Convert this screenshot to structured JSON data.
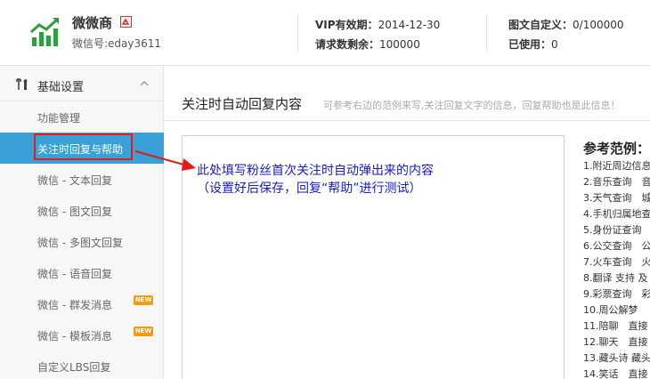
{
  "header": {
    "brand_name": "微微商",
    "wechat_id": "微信号:eday3611",
    "vip_label": "VIP有效期：",
    "vip_value": "2014-12-30",
    "requests_label": "请求数剩余：",
    "requests_value": "100000",
    "custom_label": "图文自定义：",
    "custom_value": "0/100000",
    "used_label": "已使用：",
    "used_value": "0"
  },
  "sidebar": {
    "group_title": "基础设置",
    "items": [
      {
        "label": "功能管理",
        "active": false,
        "new": false
      },
      {
        "label": "关注时回复与帮助",
        "active": true,
        "new": false
      },
      {
        "label": "微信 - 文本回复",
        "active": false,
        "new": false
      },
      {
        "label": "微信 - 图文回复",
        "active": false,
        "new": false
      },
      {
        "label": "微信 - 多图文回复",
        "active": false,
        "new": false
      },
      {
        "label": "微信 - 语音回复",
        "active": false,
        "new": false
      },
      {
        "label": "微信 - 群发消息",
        "active": false,
        "new": true
      },
      {
        "label": "微信 - 模板消息",
        "active": false,
        "new": true
      },
      {
        "label": "自定义LBS回复",
        "active": false,
        "new": false
      }
    ],
    "new_badge": "NEW"
  },
  "main": {
    "title": "关注时自动回复内容",
    "hint": "可参考右边的范例来写,关注回复文字的信息，回复帮助也是此信息！",
    "annotation_line1": "此处填写粉丝首次关注时自动弹出来的内容",
    "annotation_line2": "（设置好后保存，回复“帮助”进行测试）"
  },
  "reference": {
    "title": "参考范例：",
    "items": [
      "1.附近周边信息",
      "2.音乐查询　音",
      "3.天气查询　城",
      "4.手机归属地查",
      "5.身份证查询",
      "6.公交查询　公",
      "7.火车查询　火",
      "8.翻译 支持 及",
      "9.彩票查询　彩",
      "10.周公解梦",
      "11.陪聊　直接",
      "12.聊天　直接",
      "13.藏头诗 藏头",
      "14.笑话　直接"
    ]
  },
  "colors": {
    "active_bg": "#3aa0d8",
    "highlight_red": "#e21b1b",
    "annotation_blue": "#1a1ad0",
    "new_badge": "#f39c12",
    "logo_green": "#2e9e3e"
  }
}
